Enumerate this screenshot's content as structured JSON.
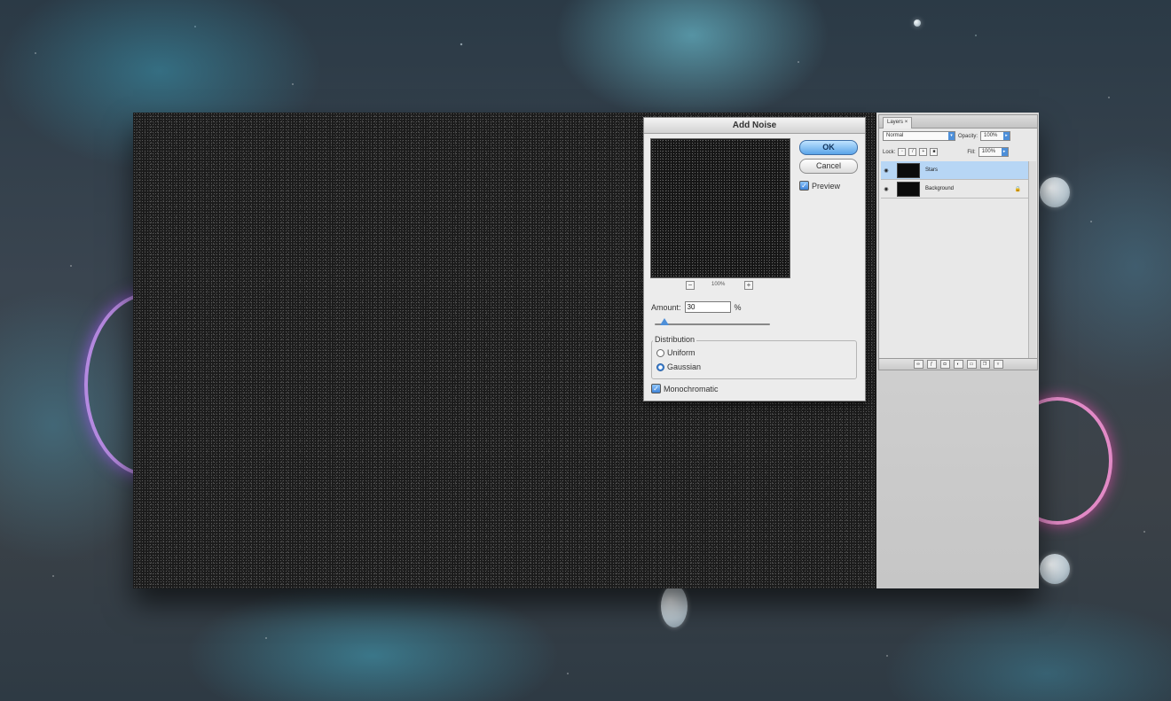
{
  "dialog": {
    "title": "Add Noise",
    "ok_label": "OK",
    "cancel_label": "Cancel",
    "preview_label": "Preview",
    "preview_checked": true,
    "zoom_out": "−",
    "zoom_value": "100%",
    "zoom_in": "+",
    "amount_label": "Amount:",
    "amount_value": "30",
    "amount_unit": "%",
    "distribution_label": "Distribution",
    "uniform_label": "Uniform",
    "gaussian_label": "Gaussian",
    "distribution_selected": "Gaussian",
    "monochromatic_label": "Monochromatic",
    "monochromatic_checked": true
  },
  "layers_panel": {
    "tab_label": "Layers",
    "blend_mode": "Normal",
    "opacity_label": "Opacity:",
    "opacity_value": "100%",
    "lock_label": "Lock:",
    "fill_label": "Fill:",
    "fill_value": "100%",
    "layers": [
      {
        "name": "Stars",
        "active": true,
        "locked": false
      },
      {
        "name": "Background",
        "active": false,
        "locked": true
      }
    ],
    "bottom_icons": [
      "link-icon",
      "fx-icon",
      "mask-icon",
      "adjustment-icon",
      "group-icon",
      "new-layer-icon",
      "trash-icon"
    ]
  }
}
